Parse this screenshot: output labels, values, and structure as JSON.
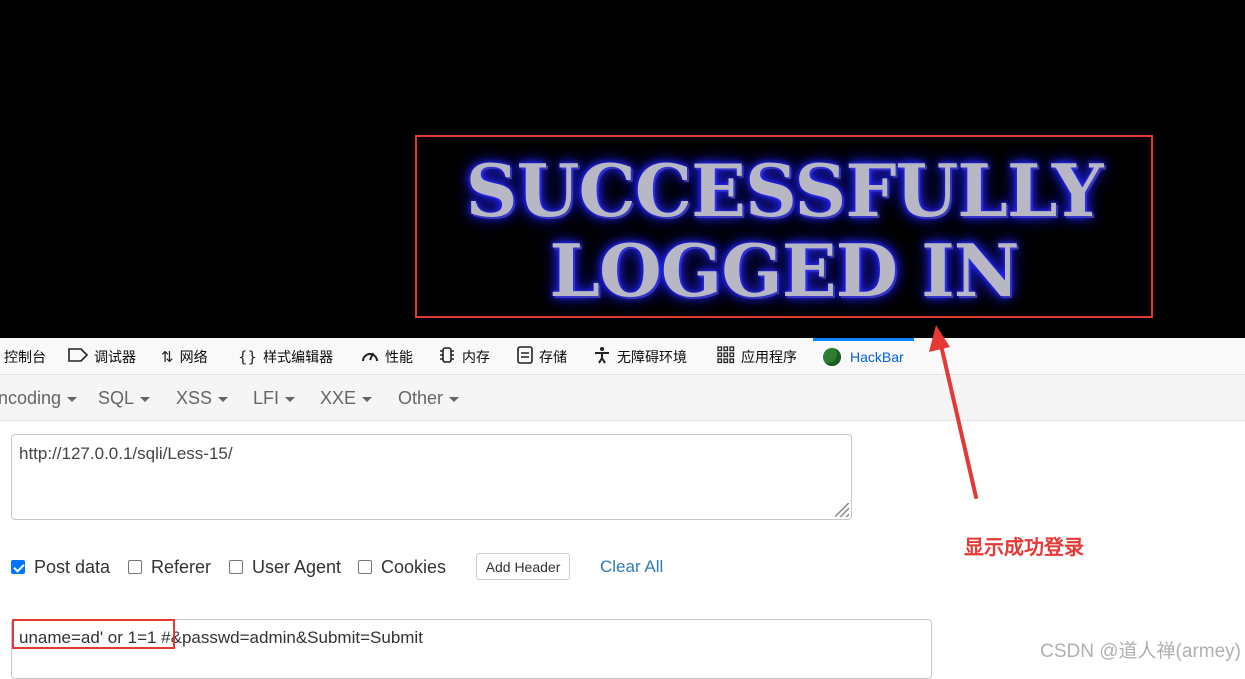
{
  "banner": {
    "line1": "SUCCESSFULLY",
    "line2": "LOGGED IN"
  },
  "devtools": {
    "tabs": [
      {
        "label": "控制台",
        "icon": "console-icon"
      },
      {
        "label": "调试器",
        "icon": "debugger-icon"
      },
      {
        "label": "网络",
        "icon": "network-icon"
      },
      {
        "label": "样式编辑器",
        "icon": "braces-icon"
      },
      {
        "label": "性能",
        "icon": "gauge-icon"
      },
      {
        "label": "内存",
        "icon": "memory-chip-icon"
      },
      {
        "label": "存储",
        "icon": "storage-icon"
      },
      {
        "label": "无障碍环境",
        "icon": "accessibility-icon"
      },
      {
        "label": "应用程序",
        "icon": "grid-icon"
      },
      {
        "label": "HackBar",
        "icon": "hackbar-logo-icon"
      }
    ],
    "active_tab": "HackBar"
  },
  "hackbar": {
    "menu": [
      "ncoding",
      "SQL",
      "XSS",
      "LFI",
      "XXE",
      "Other"
    ],
    "url": "http://127.0.0.1/sqli/Less-15/",
    "options": [
      {
        "label": "Post data",
        "checked": true
      },
      {
        "label": "Referer",
        "checked": false
      },
      {
        "label": "User Agent",
        "checked": false
      },
      {
        "label": "Cookies",
        "checked": false
      }
    ],
    "add_header_label": "Add Header",
    "clear_all_label": "Clear All",
    "post_data": "uname=ad' or 1=1 #&passwd=admin&Submit=Submit"
  },
  "annotation": {
    "note": "显示成功登录",
    "color": "#e53935"
  },
  "watermark": "CSDN @道人禅(armey)"
}
